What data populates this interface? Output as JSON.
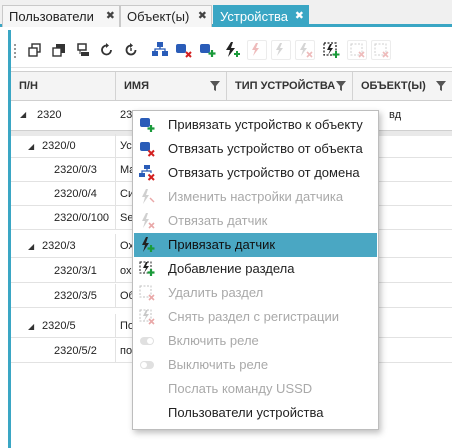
{
  "tabs": [
    {
      "label": "Пользователи",
      "active": false
    },
    {
      "label": "Объект(ы)",
      "active": false
    },
    {
      "label": "Устройства",
      "active": true
    }
  ],
  "tab_close_glyph": "✖",
  "toolbar": {
    "icons": [
      "copy-icon",
      "copy-alt-icon",
      "device-list-icon",
      "refresh-icon",
      "refresh-timer-icon",
      "device-bind-icon",
      "device-unbind-object-icon",
      "device-unbind-domain-icon",
      "sensor-icon",
      "sensor-bind-disabled-icon",
      "sensor-settings-disabled-icon",
      "sensor-unbind-disabled-icon",
      "section-add-icon",
      "section-delete-disabled-icon",
      "section-unregister-disabled-icon"
    ]
  },
  "grid": {
    "columns": [
      {
        "label": "П/Н",
        "filter": false
      },
      {
        "label": "ИМЯ",
        "filter": true
      },
      {
        "label": "ТИП УСТРОЙСТВА",
        "filter": true
      },
      {
        "label": "ОБЪЕКТ(Ы)",
        "filter": true
      }
    ],
    "filter_row": {
      "pn": "2320",
      "name": "23",
      "object": "вд"
    },
    "rows": [
      {
        "pn": "2320/0",
        "name": "Ус",
        "level": 1,
        "expander": "◢"
      },
      {
        "pn": "2320/0/3",
        "name": "Ma",
        "level": 2,
        "expander": ""
      },
      {
        "pn": "2320/0/4",
        "name": "Си",
        "level": 2,
        "expander": ""
      },
      {
        "pn": "2320/0/100",
        "name": "Se",
        "level": 2,
        "expander": ""
      },
      {
        "pn": "2320/3",
        "name": "Ох",
        "level": 1,
        "expander": "◢"
      },
      {
        "pn": "2320/3/1",
        "name": "ох",
        "level": 2,
        "expander": ""
      },
      {
        "pn": "2320/3/5",
        "name": "Об",
        "level": 2,
        "expander": ""
      },
      {
        "pn": "2320/5",
        "name": "По",
        "level": 1,
        "expander": "◢"
      },
      {
        "pn": "2320/5/2",
        "name": "по",
        "level": 2,
        "expander": ""
      }
    ],
    "filter_row_expander": "◢"
  },
  "context_menu": {
    "items": [
      {
        "label": "Привязать устройство к объекту",
        "icon": "device-bind-object-icon",
        "disabled": false,
        "hover": false
      },
      {
        "label": "Отвязать устройство от объекта",
        "icon": "device-unbind-object-icon",
        "disabled": false,
        "hover": false
      },
      {
        "label": "Отвязать устройство от домена",
        "icon": "device-unbind-domain-icon",
        "disabled": false,
        "hover": false
      },
      {
        "label": "Изменить настройки датчика",
        "icon": "sensor-settings-icon",
        "disabled": true,
        "hover": false
      },
      {
        "label": "Отвязать датчик",
        "icon": "sensor-unbind-icon",
        "disabled": true,
        "hover": false
      },
      {
        "label": "Привязать датчик",
        "icon": "sensor-bind-icon",
        "disabled": false,
        "hover": true
      },
      {
        "label": "Добавление раздела",
        "icon": "section-add-icon",
        "disabled": false,
        "hover": false
      },
      {
        "label": "Удалить раздел",
        "icon": "section-delete-icon",
        "disabled": true,
        "hover": false
      },
      {
        "label": "Снять раздел с регистрации",
        "icon": "section-unregister-icon",
        "disabled": true,
        "hover": false
      },
      {
        "label": "Включить реле",
        "icon": "relay-on-icon",
        "disabled": true,
        "hover": false
      },
      {
        "label": "Выключить реле",
        "icon": "relay-off-icon",
        "disabled": true,
        "hover": false
      },
      {
        "label": "Послать команду USSD",
        "icon": "",
        "disabled": true,
        "hover": false
      },
      {
        "label": "Пользователи устройства",
        "icon": "",
        "disabled": false,
        "hover": false
      }
    ]
  },
  "colors": {
    "accent": "#3aa6c4",
    "hover": "#4aa7c3",
    "disabled_text": "#a9a9a9"
  }
}
